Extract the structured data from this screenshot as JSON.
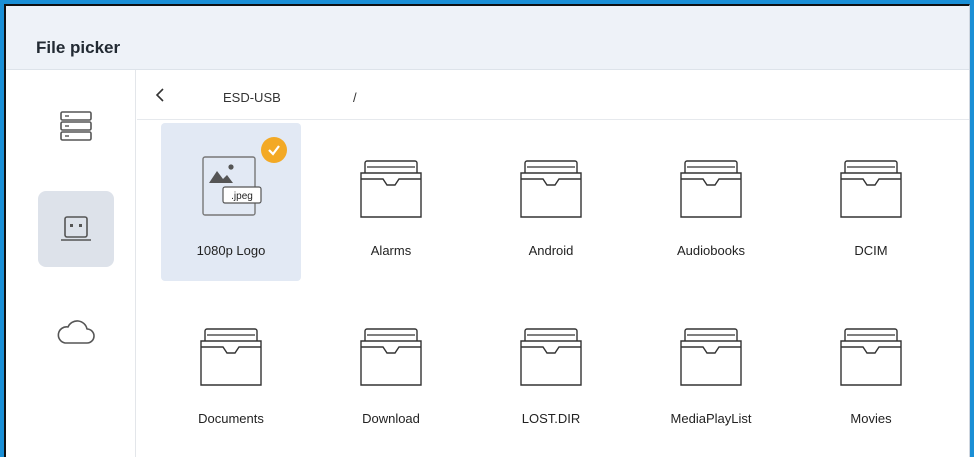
{
  "window": {
    "title": "File picker"
  },
  "sidebar": {
    "items": [
      {
        "name": "storage-list",
        "icon": "storage-list-icon",
        "active": false
      },
      {
        "name": "usb",
        "icon": "usb-drive-icon",
        "active": true
      },
      {
        "name": "cloud",
        "icon": "cloud-icon",
        "active": false
      }
    ]
  },
  "path": {
    "back_icon": "chevron-left-icon",
    "segments": [
      "ESD-USB",
      "/"
    ]
  },
  "files": [
    {
      "label": "1080p Logo",
      "type": "image",
      "badge": ".jpeg",
      "selected": true
    },
    {
      "label": "Alarms",
      "type": "folder"
    },
    {
      "label": "Android",
      "type": "folder"
    },
    {
      "label": "Audiobooks",
      "type": "folder"
    },
    {
      "label": "DCIM",
      "type": "folder"
    },
    {
      "label": "Documents",
      "type": "folder"
    },
    {
      "label": "Download",
      "type": "folder"
    },
    {
      "label": "LOST.DIR",
      "type": "folder"
    },
    {
      "label": "MediaPlayList",
      "type": "folder"
    },
    {
      "label": "Movies",
      "type": "folder"
    }
  ],
  "colors": {
    "accent_check": "#f3a925",
    "selected_bg": "#e2e9f4",
    "titlebar_bg": "#eef2f8"
  }
}
